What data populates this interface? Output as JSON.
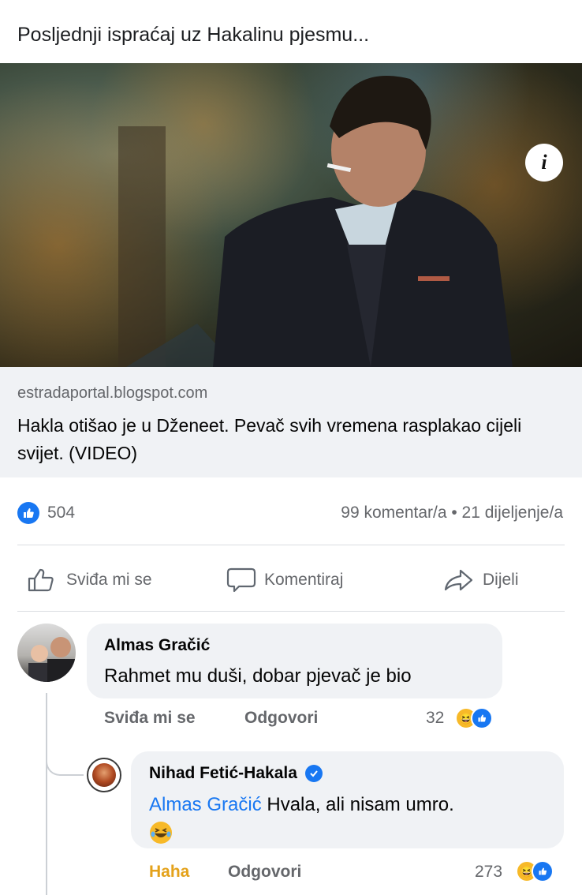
{
  "post": {
    "text": "Posljednji ispraćaj uz Hakalinu pjesmu...",
    "info_icon_glyph": "i"
  },
  "link": {
    "domain": "estradaportal.blogspot.com",
    "title": "Hakla otišao je u Dženeet. Pevač svih vremena rasplakao cijeli svijet. (VIDEO)"
  },
  "stats": {
    "likes": "504",
    "comments_shares": "99 komentar/a • 21 dijeljenje/a"
  },
  "actions": {
    "like": "Sviđa mi se",
    "comment": "Komentiraj",
    "share": "Dijeli"
  },
  "comment1": {
    "author": "Almas Gračić",
    "text": "Rahmet mu duši, dobar pjevač je bio",
    "like_label": "Sviđa mi se",
    "reply_label": "Odgovori",
    "reaction_count": "32"
  },
  "reply": {
    "author": "Nihad Fetić-Hakala",
    "mention": "Almas Gračić",
    "text": " Hvala, ali nisam umro.",
    "reaction_label": "Haha",
    "reply_label": "Odgovori",
    "reaction_count": "273"
  },
  "colors": {
    "facebook_blue": "#1877f2",
    "haha_orange": "#e4a21b",
    "muted_text": "#65676b",
    "bubble_bg": "#f0f2f5"
  }
}
